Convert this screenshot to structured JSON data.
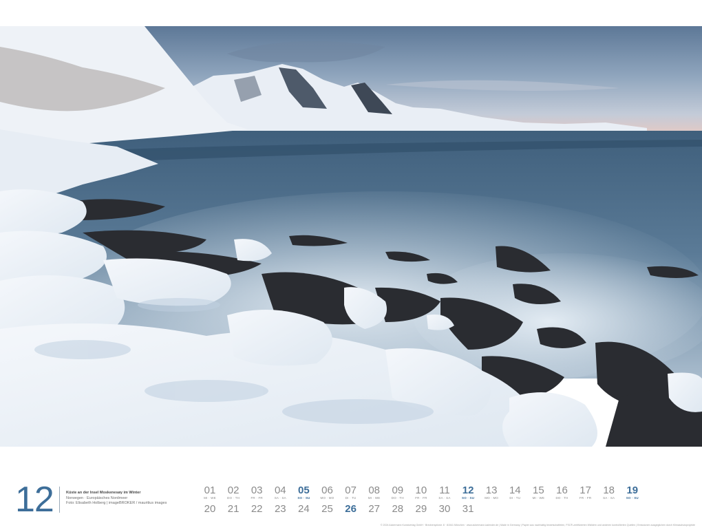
{
  "month": "12",
  "caption": {
    "title": "Küste an der Insel Moskenesøy im Winter",
    "location": "Norwegen · Europäisches Nordmeer",
    "credit": "Foto: Elisabeth Holberg | imageBROKER / mauritius images"
  },
  "calendar": {
    "row1": [
      {
        "num": "01",
        "name": "MI · WE",
        "style": "normal"
      },
      {
        "num": "02",
        "name": "DO · TH",
        "style": "normal"
      },
      {
        "num": "03",
        "name": "FR · FR",
        "style": "normal"
      },
      {
        "num": "04",
        "name": "SA · SA",
        "style": "sat"
      },
      {
        "num": "05",
        "name": "SO · SU",
        "style": "sun"
      },
      {
        "num": "06",
        "name": "MO · MO",
        "style": "normal"
      },
      {
        "num": "07",
        "name": "DI · TU",
        "style": "normal"
      },
      {
        "num": "08",
        "name": "MI · WE",
        "style": "normal"
      },
      {
        "num": "09",
        "name": "DO · TH",
        "style": "normal"
      },
      {
        "num": "10",
        "name": "FR · FR",
        "style": "normal"
      },
      {
        "num": "11",
        "name": "SA · SA",
        "style": "sat"
      },
      {
        "num": "12",
        "name": "SO · SU",
        "style": "sun"
      },
      {
        "num": "13",
        "name": "MO · MO",
        "style": "normal"
      },
      {
        "num": "14",
        "name": "DI · TU",
        "style": "normal"
      },
      {
        "num": "15",
        "name": "MI · WE",
        "style": "normal"
      },
      {
        "num": "16",
        "name": "DO · TH",
        "style": "normal"
      },
      {
        "num": "17",
        "name": "FR · FR",
        "style": "normal"
      },
      {
        "num": "18",
        "name": "SA · SA",
        "style": "sat"
      },
      {
        "num": "19",
        "name": "SO · SU",
        "style": "sun"
      }
    ],
    "row2": [
      {
        "num": "20",
        "name": "MO · MO",
        "style": "normal"
      },
      {
        "num": "21",
        "name": "DI · TU",
        "style": "normal"
      },
      {
        "num": "22",
        "name": "MI · WE",
        "style": "normal"
      },
      {
        "num": "23",
        "name": "DO · TH",
        "style": "normal"
      },
      {
        "num": "24",
        "name": "FR · FR",
        "style": "normal"
      },
      {
        "num": "25",
        "name": "SA · SA",
        "style": "sat"
      },
      {
        "num": "26",
        "name": "SO · SU",
        "style": "sun"
      },
      {
        "num": "27",
        "name": "MO · MO",
        "style": "normal"
      },
      {
        "num": "28",
        "name": "DI · TU",
        "style": "normal"
      },
      {
        "num": "29",
        "name": "MI · WE",
        "style": "normal"
      },
      {
        "num": "30",
        "name": "DO · TH",
        "style": "normal"
      },
      {
        "num": "31",
        "name": "FR · FR",
        "style": "normal"
      }
    ]
  },
  "fineprint": "© 2024 Ackermann Kunstverlag GmbH · Brecherspitzstr. 8 · 81541 München · www.ackermann-kalender.de | Made in Germany | Papier aus nachhaltig bewirtschafteten, FSC®-zertifizierten Wäldern und anderen kontrollierten Quellen | Emissionen ausgeglichen durch Klimaschutzprojekte",
  "colors": {
    "accent": "#3d6e99",
    "muted": "#8a8a8a",
    "background": "#ffffff"
  }
}
